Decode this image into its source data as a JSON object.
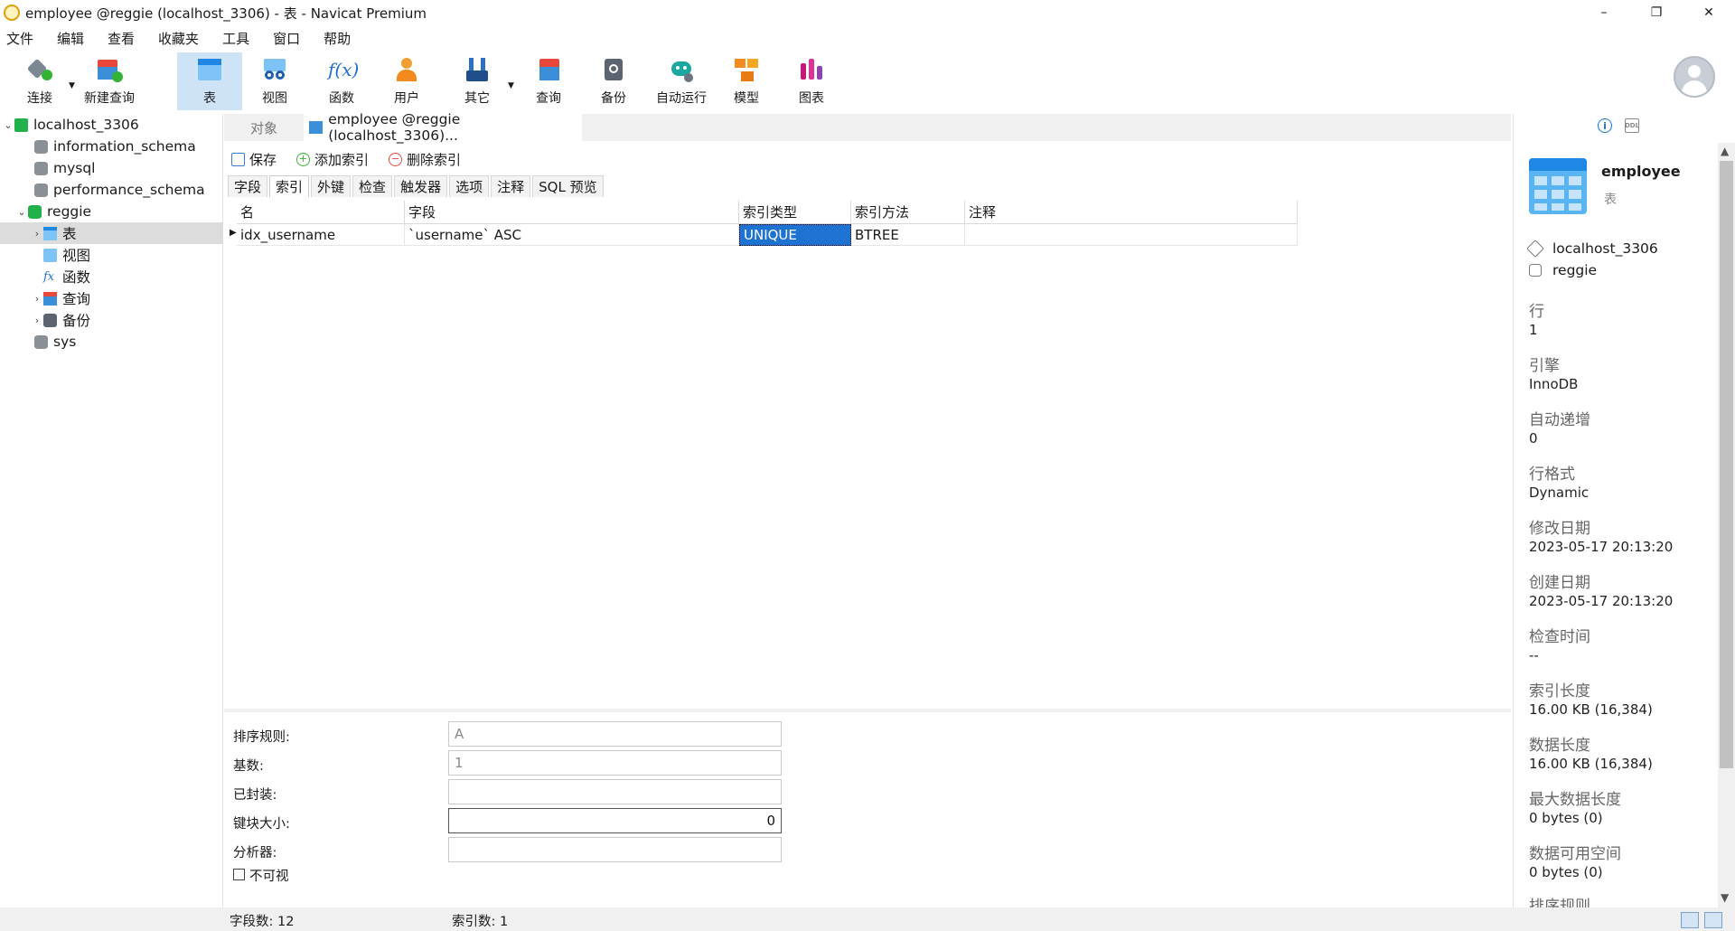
{
  "window": {
    "title": "employee @reggie (localhost_3306) - 表 - Navicat Premium",
    "minimize": "–",
    "restore": "❐",
    "close": "✕"
  },
  "menu": [
    "文件",
    "编辑",
    "查看",
    "收藏夹",
    "工具",
    "窗口",
    "帮助"
  ],
  "toolbar": [
    {
      "label": "连接",
      "icon": "connect-icon"
    },
    {
      "label": "新建查询",
      "icon": "new-query-icon"
    },
    {
      "label": "表",
      "icon": "table-icon",
      "active": true
    },
    {
      "label": "视图",
      "icon": "view-icon"
    },
    {
      "label": "函数",
      "icon": "function-icon"
    },
    {
      "label": "用户",
      "icon": "user-icon"
    },
    {
      "label": "其它",
      "icon": "tools-icon"
    },
    {
      "label": "查询",
      "icon": "query-icon"
    },
    {
      "label": "备份",
      "icon": "backup-icon"
    },
    {
      "label": "自动运行",
      "icon": "robot-icon"
    },
    {
      "label": "模型",
      "icon": "model-icon"
    },
    {
      "label": "图表",
      "icon": "chart-icon"
    }
  ],
  "tree": {
    "connection": "localhost_3306",
    "databases": [
      "information_schema",
      "mysql",
      "performance_schema",
      "reggie",
      "sys"
    ],
    "reggie_children": [
      "表",
      "视图",
      "函数",
      "查询",
      "备份"
    ]
  },
  "tabs": {
    "objects": "对象",
    "active": "employee @reggie (localhost_3306)..."
  },
  "actions": {
    "save": "保存",
    "add_index": "添加索引",
    "delete_index": "删除索引"
  },
  "subtabs": [
    "字段",
    "索引",
    "外键",
    "检查",
    "触发器",
    "选项",
    "注释",
    "SQL 预览"
  ],
  "grid": {
    "headers": [
      "名",
      "字段",
      "索引类型",
      "索引方法",
      "注释"
    ],
    "rows": [
      {
        "name": "idx_username",
        "fields": "`username` ASC",
        "type": "UNIQUE",
        "method": "BTREE",
        "comment": ""
      }
    ]
  },
  "props": {
    "collation_label": "排序规则:",
    "collation_value": "A",
    "cardinality_label": "基数:",
    "cardinality_value": "1",
    "packed_label": "已封装:",
    "packed_value": "",
    "key_block_label": "键块大小:",
    "key_block_value": "0",
    "parser_label": "分析器:",
    "parser_value": "",
    "invisible_label": "不可视"
  },
  "status": {
    "field_count": "字段数: 12",
    "index_count": "索引数: 1"
  },
  "info": {
    "name": "employee",
    "kind": "表",
    "connection": "localhost_3306",
    "database": "reggie",
    "fields": [
      {
        "label": "行",
        "value": "1"
      },
      {
        "label": "引擎",
        "value": "InnoDB"
      },
      {
        "label": "自动递增",
        "value": "0"
      },
      {
        "label": "行格式",
        "value": "Dynamic"
      },
      {
        "label": "修改日期",
        "value": "2023-05-17 20:13:20"
      },
      {
        "label": "创建日期",
        "value": "2023-05-17 20:13:20"
      },
      {
        "label": "检查时间",
        "value": "--"
      },
      {
        "label": "索引长度",
        "value": "16.00 KB (16,384)"
      },
      {
        "label": "数据长度",
        "value": "16.00 KB (16,384)"
      },
      {
        "label": "最大数据长度",
        "value": "0 bytes (0)"
      },
      {
        "label": "数据可用空间",
        "value": "0 bytes (0)"
      },
      {
        "label": "排序规则",
        "value": ""
      }
    ]
  },
  "colors": {
    "accent": "#1e73d2",
    "toolbar_active": "#cfe3f6"
  }
}
